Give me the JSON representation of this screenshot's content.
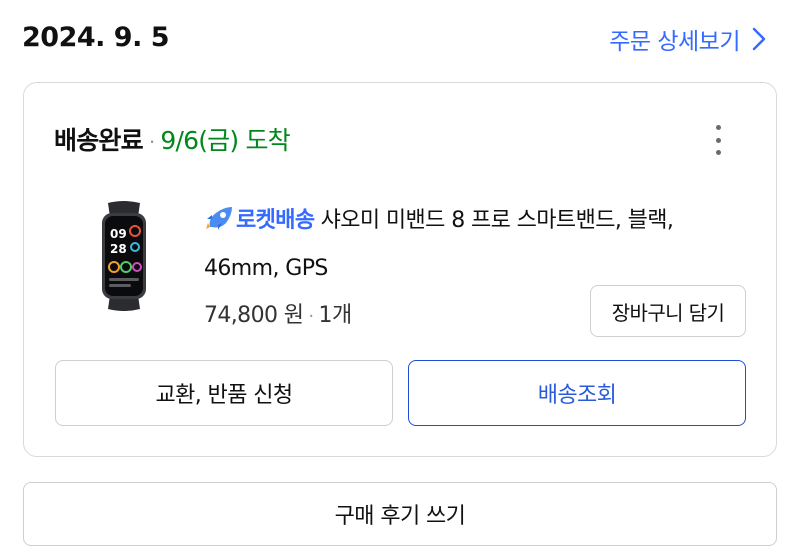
{
  "order": {
    "date": "2024. 9. 5",
    "detail_link_label": "주문 상세보기",
    "detail_link_icon": "chevron-right-icon"
  },
  "delivery": {
    "status_label": "배송완료",
    "separator": "·",
    "arrival_text": "9/6(금) 도착",
    "status_color": "#00891a",
    "more_icon": "vertical-ellipsis-icon"
  },
  "product": {
    "badge_label": "로켓배송",
    "badge_icon": "rocket-icon",
    "badge_color": "#346aff",
    "name": "샤오미 미밴드 8 프로 스마트밴드, 블랙, 46mm, GPS",
    "price": "74,800 원",
    "separator": "·",
    "quantity": "1개",
    "thumbnail_icon": "smartband-image",
    "watch_time_hour": "09",
    "watch_time_min": "28"
  },
  "actions": {
    "cart_label": "장바구니 담기",
    "return_label": "교환, 반품 신청",
    "tracking_label": "배송조회",
    "review_label": "구매 후기 쓰기",
    "accent_color": "#1a4fd6"
  }
}
